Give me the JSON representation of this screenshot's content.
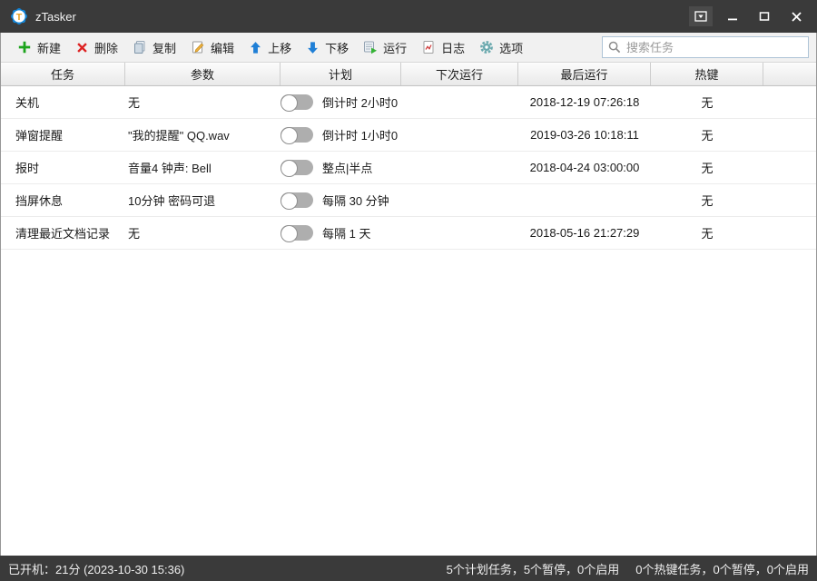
{
  "window": {
    "title": "zTasker",
    "controls": [
      {
        "icon": "minimize-to-tray-icon"
      },
      {
        "icon": "minimize-icon"
      },
      {
        "icon": "maximize-icon"
      },
      {
        "icon": "close-icon"
      }
    ]
  },
  "toolbar": {
    "buttons": [
      {
        "icon": "plus-icon",
        "label": "新建"
      },
      {
        "icon": "delete-x-icon",
        "label": "删除"
      },
      {
        "icon": "copy-icon",
        "label": "复制"
      },
      {
        "icon": "edit-pencil-icon",
        "label": "编辑"
      },
      {
        "icon": "arrow-up-icon",
        "label": "上移"
      },
      {
        "icon": "arrow-down-icon",
        "label": "下移"
      },
      {
        "icon": "run-icon",
        "label": "运行"
      },
      {
        "icon": "log-icon",
        "label": "日志"
      },
      {
        "icon": "gear-icon",
        "label": "选项"
      }
    ],
    "search": {
      "icon": "search-icon",
      "placeholder": "搜索任务",
      "value": ""
    }
  },
  "table": {
    "columns": [
      "任务",
      "参数",
      "计划",
      "下次运行",
      "最后运行",
      "热键"
    ],
    "rows": [
      {
        "task": "关机",
        "params": "无",
        "enabled": false,
        "schedule": "倒计时 2小时0",
        "next_run": "",
        "last_run": "2018-12-19 07:26:18",
        "hotkey": "无"
      },
      {
        "task": "弹窗提醒",
        "params": "\"我的提醒\" QQ.wav",
        "enabled": false,
        "schedule": "倒计时 1小时0",
        "next_run": "",
        "last_run": "2019-03-26 10:18:11",
        "hotkey": "无"
      },
      {
        "task": "报时",
        "params": "音量4 钟声: Bell",
        "enabled": false,
        "schedule": "整点|半点",
        "next_run": "",
        "last_run": "2018-04-24 03:00:00",
        "hotkey": "无"
      },
      {
        "task": "挡屏休息",
        "params": "10分钟 密码可退",
        "enabled": false,
        "schedule": "每隔 30 分钟",
        "next_run": "",
        "last_run": "",
        "hotkey": "无"
      },
      {
        "task": "清理最近文档记录",
        "params": "无",
        "enabled": false,
        "schedule": "每隔 1 天",
        "next_run": "",
        "last_run": "2018-05-16 21:27:29",
        "hotkey": "无"
      }
    ]
  },
  "statusbar": {
    "left": "已开机：21分 (2023-10-30 15:36)",
    "plan_summary": "5个计划任务，5个暂停，0个启用",
    "hotkey_summary": "0个热键任务，0个暂停，0个启用"
  },
  "colors": {
    "titlebar_bg": "#3a3a3a",
    "statusbar_bg": "#3a3a3a",
    "accent_blue": "#1f7fd6",
    "app_icon_blue": "#1486d8",
    "new_green": "#1ca41c",
    "delete_red": "#dd2222",
    "toggle_off_track": "#aeaeae"
  }
}
